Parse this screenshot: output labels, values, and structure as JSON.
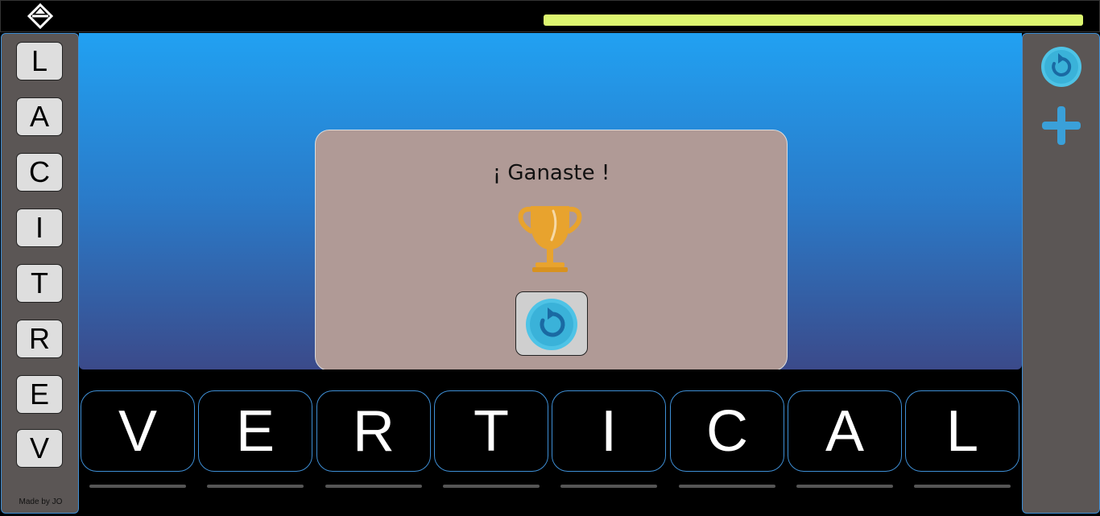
{
  "app": {
    "logo_icon": "diamond-arrows-icon",
    "progress": 1.0,
    "progress_color": "#dcf56f"
  },
  "left_sidebar": {
    "letters": [
      "L",
      "A",
      "C",
      "I",
      "T",
      "R",
      "E",
      "V"
    ],
    "credit": "Made by JO"
  },
  "right_sidebar": {
    "buttons": [
      {
        "icon": "restart-icon"
      },
      {
        "icon": "plus-icon"
      }
    ]
  },
  "modal": {
    "title": "¡ Ganaste !",
    "trophy_icon": "trophy-icon",
    "replay_icon": "restart-icon"
  },
  "answer": {
    "letters": [
      "V",
      "E",
      "R",
      "T",
      "I",
      "C",
      "A",
      "L"
    ]
  },
  "colors": {
    "accent_blue": "#3e8fd6",
    "panel_gray": "#5b5655",
    "modal_bg": "#b09a96",
    "trophy": "#e8a32e"
  }
}
